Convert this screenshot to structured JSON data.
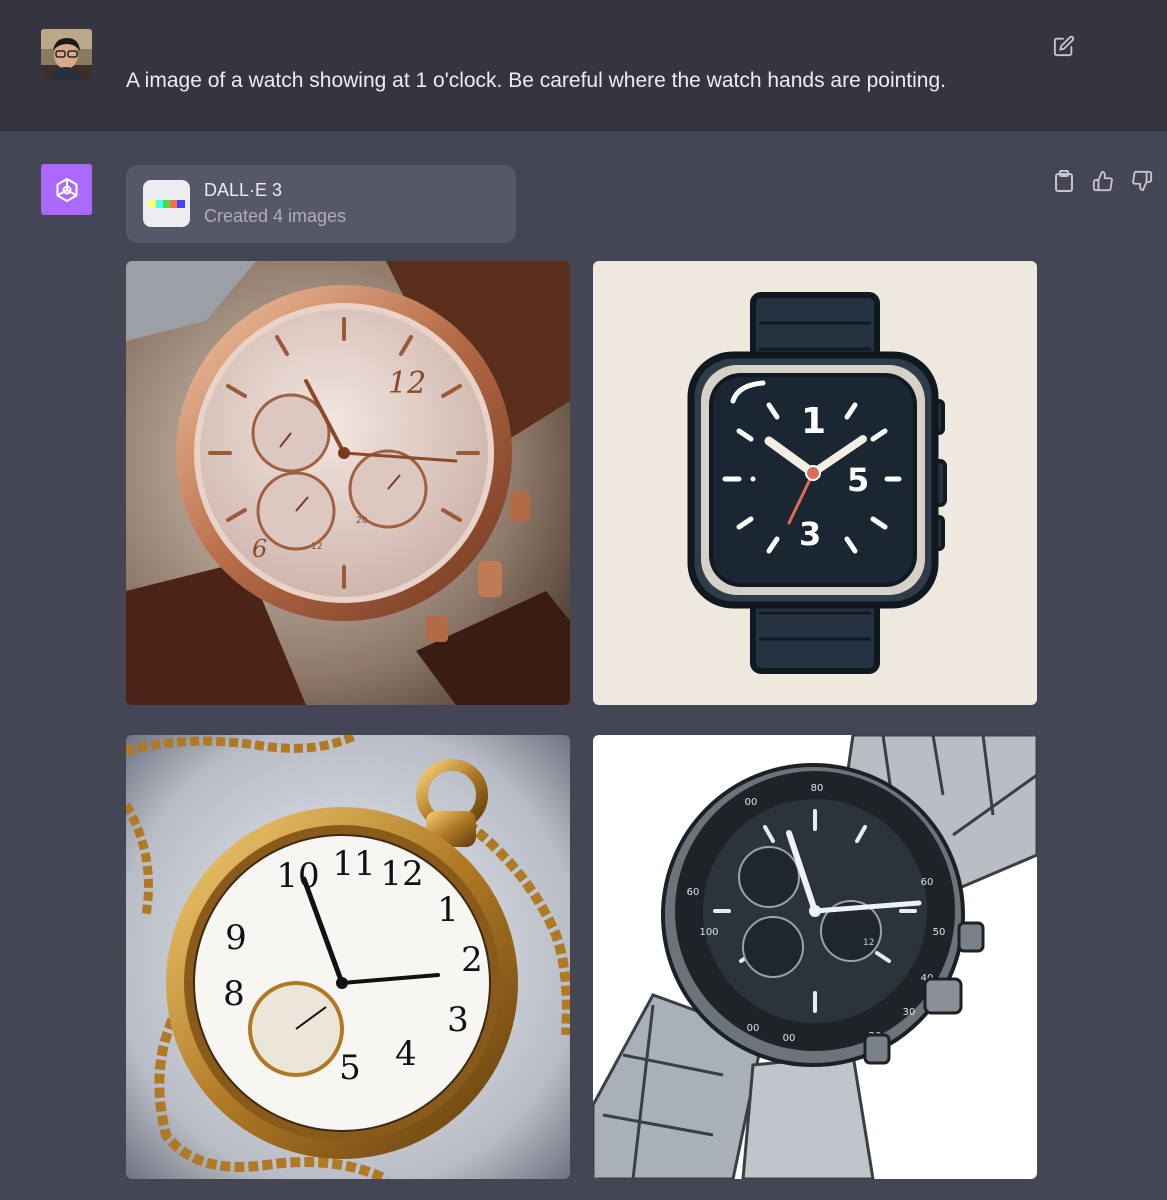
{
  "user_message": {
    "text": "A image of a watch showing at 1 o'clock. Be careful where the watch hands are pointing.",
    "avatar": "user-avatar-photo",
    "edit_icon": "edit-icon"
  },
  "assistant_message": {
    "avatar_icon": "openai-logo-icon",
    "brand_color": "#ab68ff",
    "tool": {
      "name": "DALL·E 3",
      "status": "Created 4 images",
      "logo_icon": "dalle-logo-icon"
    },
    "actions": [
      "copy-icon",
      "thumbs-up-icon",
      "thumbs-down-icon"
    ],
    "images": [
      {
        "numerals": [
          "12",
          "6"
        ],
        "subdial_text": [
          "20",
          "12"
        ]
      },
      {
        "numerals": [
          "1",
          "5",
          "3"
        ]
      },
      {
        "numerals": [
          "11",
          "12",
          "1",
          "2",
          "3",
          "4",
          "5",
          "9",
          "8",
          "10"
        ]
      },
      {
        "bezel_numbers": [
          "00",
          "80",
          "60",
          "50",
          "40",
          "30",
          "20",
          "00",
          "00",
          "100",
          "60"
        ],
        "subdial_text": [
          "12"
        ]
      }
    ]
  },
  "colors": {
    "background": "#343541",
    "assistant_background": "#444654",
    "card": "#565869",
    "text": "#ececf1",
    "muted_text": "#acacbe"
  }
}
